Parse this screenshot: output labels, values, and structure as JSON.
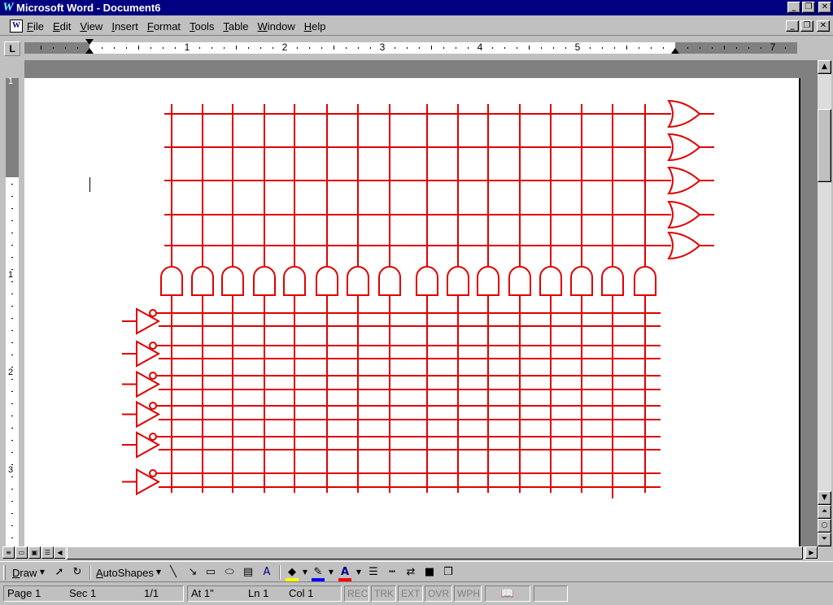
{
  "window": {
    "title": "Microsoft Word - Document6",
    "app_icon": "W",
    "buttons": [
      "minimize",
      "restore",
      "close"
    ]
  },
  "menu": {
    "items": [
      "File",
      "Edit",
      "View",
      "Insert",
      "Format",
      "Tools",
      "Table",
      "Window",
      "Help"
    ]
  },
  "ruler": {
    "corner_label": "L",
    "numbers": [
      "1",
      "2",
      "3",
      "4",
      "5",
      "7"
    ],
    "vertical_numbers": [
      "1",
      "1",
      "2",
      "3"
    ]
  },
  "drawing_toolbar": {
    "draw_label": "Draw",
    "autoshapes_label": "AutoShapes",
    "icons": [
      "select-objects-icon",
      "free-rotate-icon",
      "line-icon",
      "arrow-icon",
      "rectangle-icon",
      "oval-icon",
      "text-box-icon",
      "wordart-icon",
      "fill-color-icon",
      "line-color-icon",
      "font-color-icon",
      "line-style-icon",
      "dash-style-icon",
      "arrow-style-icon",
      "shadow-icon",
      "3d-icon"
    ],
    "colors": {
      "fill": "#ffff00",
      "line": "#0000ff",
      "font": "#ff0000"
    }
  },
  "statusbar": {
    "page": "Page 1",
    "sec": "Sec 1",
    "pages": "1/1",
    "at": "At 1\"",
    "ln": "Ln 1",
    "col": "Col 1",
    "modes": [
      "REC",
      "TRK",
      "EXT",
      "OVR",
      "WPH"
    ]
  },
  "diagram": {
    "color": "#e00000",
    "or_gates": 5,
    "and_gates": 16,
    "not_gates": 6
  }
}
